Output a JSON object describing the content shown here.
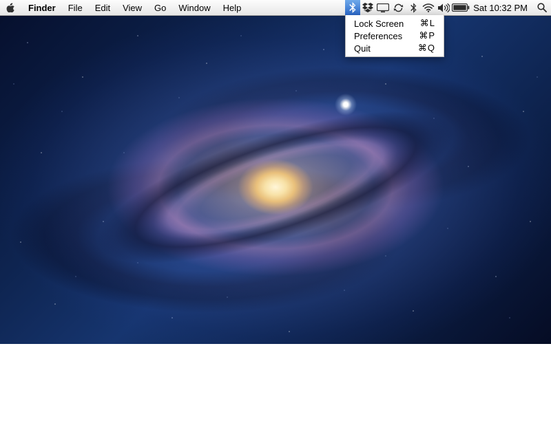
{
  "menubar": {
    "app_name": "Finder",
    "menus": [
      "File",
      "Edit",
      "View",
      "Go",
      "Window",
      "Help"
    ],
    "clock": "Sat 10:32 PM"
  },
  "status_icons": [
    "bluetooth-icon",
    "dropbox-icon",
    "display-icon",
    "sync-icon",
    "bluetooth-icon-2",
    "wifi-icon",
    "volume-icon",
    "battery-icon"
  ],
  "dropdown": {
    "owner_icon": "bluetooth-icon",
    "items": [
      {
        "label": "Lock Screen",
        "shortcut": "⌘L"
      },
      {
        "label": "Preferences",
        "shortcut": "⌘P"
      },
      {
        "label": "Quit",
        "shortcut": "⌘Q"
      }
    ]
  }
}
